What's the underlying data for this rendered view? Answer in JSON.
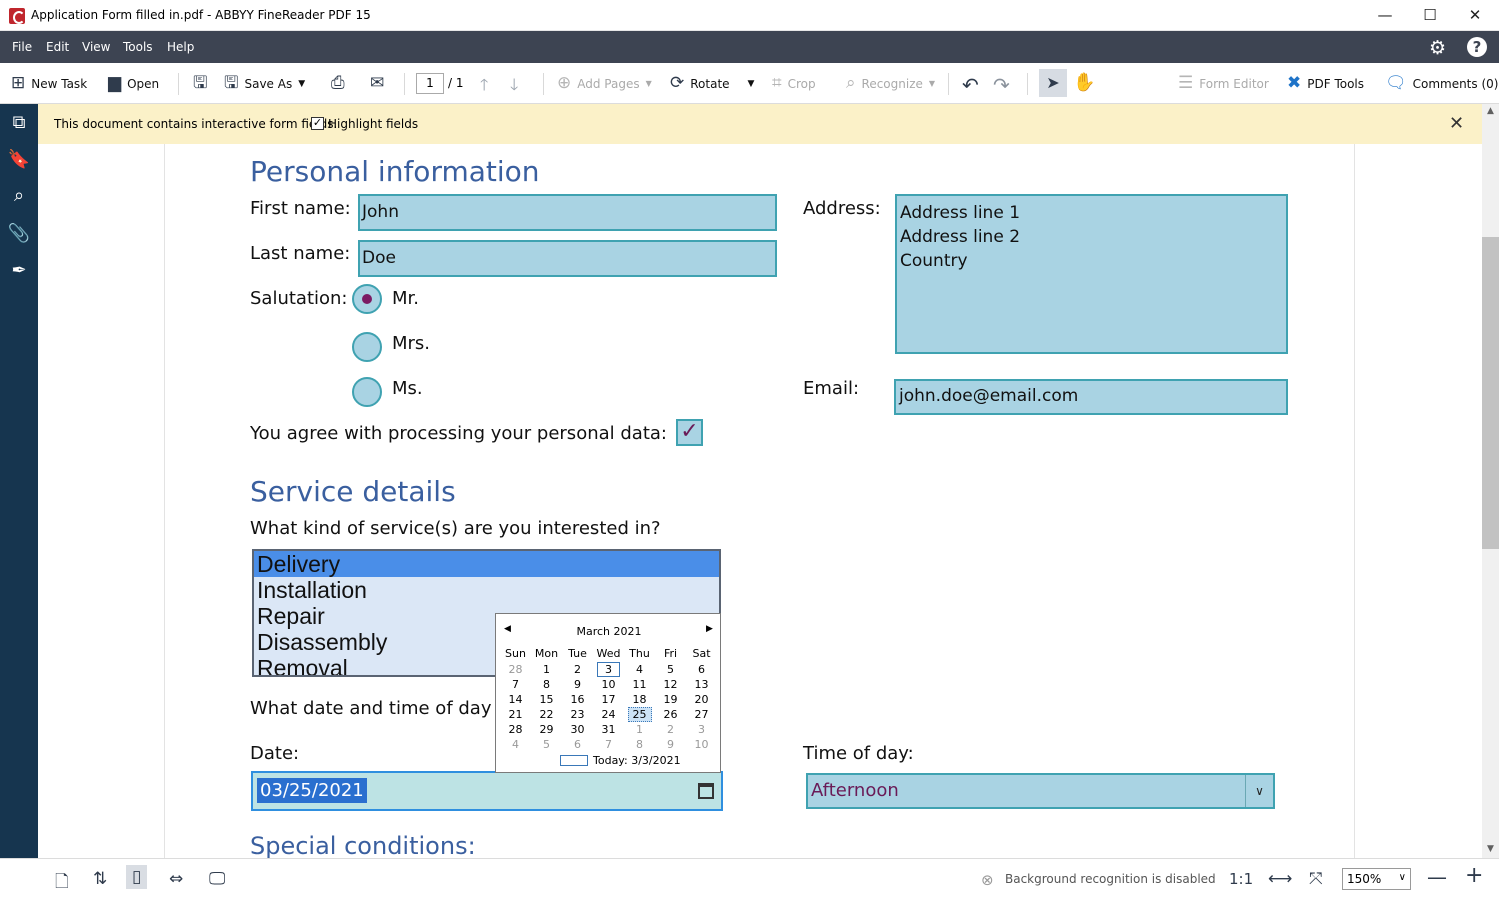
{
  "window": {
    "title": "Application Form filled in.pdf - ABBYY FineReader PDF 15",
    "minimize": "—",
    "maximize": "☐",
    "close": "✕"
  },
  "menu": [
    "File",
    "Edit",
    "View",
    "Tools",
    "Help"
  ],
  "toolbar": {
    "new_task": "New Task",
    "open": "Open",
    "save_as": "Save As",
    "page_current": "1",
    "page_total": "/ 1",
    "add_pages": "Add Pages",
    "rotate": "Rotate",
    "crop": "Crop",
    "recognize": "Recognize",
    "form_editor": "Form Editor",
    "pdf_tools": "PDF Tools",
    "comments": "Comments (0)"
  },
  "notice": {
    "message": "This document contains interactive form fields.",
    "highlight_label": "Highlight fields",
    "highlight_checked": true
  },
  "form": {
    "personal_heading": "Personal information",
    "first_name_label": "First name:",
    "first_name_value": "John",
    "last_name_label": "Last name:",
    "last_name_value": "Doe",
    "salutation_label": "Salutation:",
    "salutation_options": [
      "Mr.",
      "Mrs.",
      "Ms."
    ],
    "salutation_selected": "Mr.",
    "address_label": "Address:",
    "address_lines": [
      "Address line 1",
      "Address line 2",
      "Country"
    ],
    "email_label": "Email:",
    "email_value": "john.doe@email.com",
    "agree_label": "You agree with processing your personal data:",
    "agree_checked": true,
    "service_heading": "Service details",
    "service_question": "What kind of service(s) are you interested in?",
    "services": [
      "Delivery",
      "Installation",
      "Repair",
      "Disassembly",
      "Removal"
    ],
    "service_selected": "Delivery",
    "datetime_question": "What date and time of day",
    "date_label": "Date:",
    "date_value": "03/25/2021",
    "time_label": "Time of day:",
    "time_value": "Afternoon",
    "special_heading": "Special conditions:"
  },
  "calendar": {
    "month": "March 2021",
    "weekdays": [
      "Sun",
      "Mon",
      "Tue",
      "Wed",
      "Thu",
      "Fri",
      "Sat"
    ],
    "weeks": [
      [
        "28",
        "1",
        "2",
        "3",
        "4",
        "5",
        "6"
      ],
      [
        "7",
        "8",
        "9",
        "10",
        "11",
        "12",
        "13"
      ],
      [
        "14",
        "15",
        "16",
        "17",
        "18",
        "19",
        "20"
      ],
      [
        "21",
        "22",
        "23",
        "24",
        "25",
        "26",
        "27"
      ],
      [
        "28",
        "29",
        "30",
        "31",
        "1",
        "2",
        "3"
      ],
      [
        "4",
        "5",
        "6",
        "7",
        "8",
        "9",
        "10"
      ]
    ],
    "today_day": "3",
    "selected_day": "25",
    "today_label": "Today: 3/3/2021"
  },
  "status": {
    "background_recognition": "Background recognition is disabled",
    "one_to_one": "1:1",
    "zoom": "150%"
  },
  "colors": {
    "menubar": "#3d4452",
    "sidebar": "#16354f",
    "notice_bg": "#fbf1c8",
    "field_bg": "#a9d3e3",
    "field_border": "#3fa2b1",
    "heading": "#3a5f9f",
    "selected_item": "#4a8ee8"
  }
}
